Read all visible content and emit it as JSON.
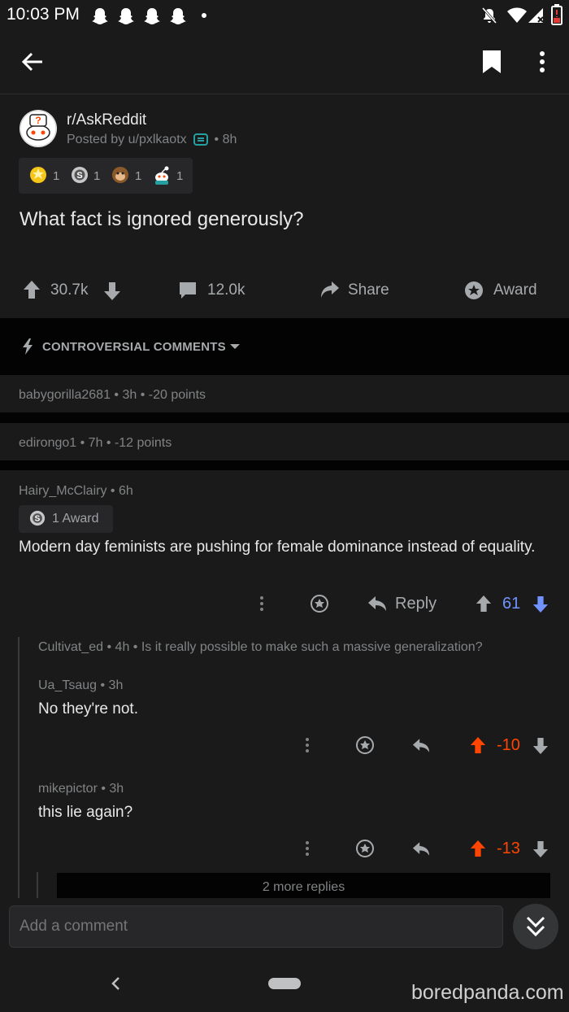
{
  "status_bar": {
    "time": "10:03 PM"
  },
  "post": {
    "subreddit": "r/AskReddit",
    "posted_by_prefix": "Posted by u/pxlkaotx",
    "age": "• 8h",
    "awards": [
      {
        "icon": "silver-award-icon",
        "count": "1"
      },
      {
        "icon": "starstruck-award-icon",
        "count": "1"
      },
      {
        "icon": "monkey-award-icon",
        "count": "1"
      },
      {
        "icon": "snoo-award-icon",
        "count": "1"
      }
    ],
    "title": "What fact is ignored generously?",
    "actions": {
      "score": "30.7k",
      "comments": "12.0k",
      "share": "Share",
      "award": "Award"
    }
  },
  "sort": {
    "label": "CONTROVERSIAL COMMENTS"
  },
  "collapsed_comments": [
    {
      "text": "babygorilla2681 • 3h • -20 points"
    },
    {
      "text": "edirongo1 • 7h • -12 points"
    }
  ],
  "main_comment": {
    "author_line": "Hairy_McClairy • 6h",
    "award_chip": "1 Award",
    "body": "Modern day feminists are pushing for female dominance instead of equality.",
    "reply_label": "Reply",
    "score": "61"
  },
  "replies": [
    {
      "collapsed_line": "Cultivat_ed • 4h • Is it really possible to make such a massive generalization?"
    },
    {
      "author_line": "Ua_Tsaug • 3h",
      "body": "No they're not.",
      "score": "-10"
    },
    {
      "author_line": "mikepictor • 3h",
      "body": "this lie again?",
      "score": "-13"
    }
  ],
  "more_replies": "2 more replies",
  "comment_input": {
    "placeholder": "Add a comment"
  },
  "watermark": "boredpanda.com",
  "colors": {
    "upvote": "#ff4500",
    "downvote": "#7193ff",
    "background": "#1a1a1b",
    "divider": "#030303"
  }
}
